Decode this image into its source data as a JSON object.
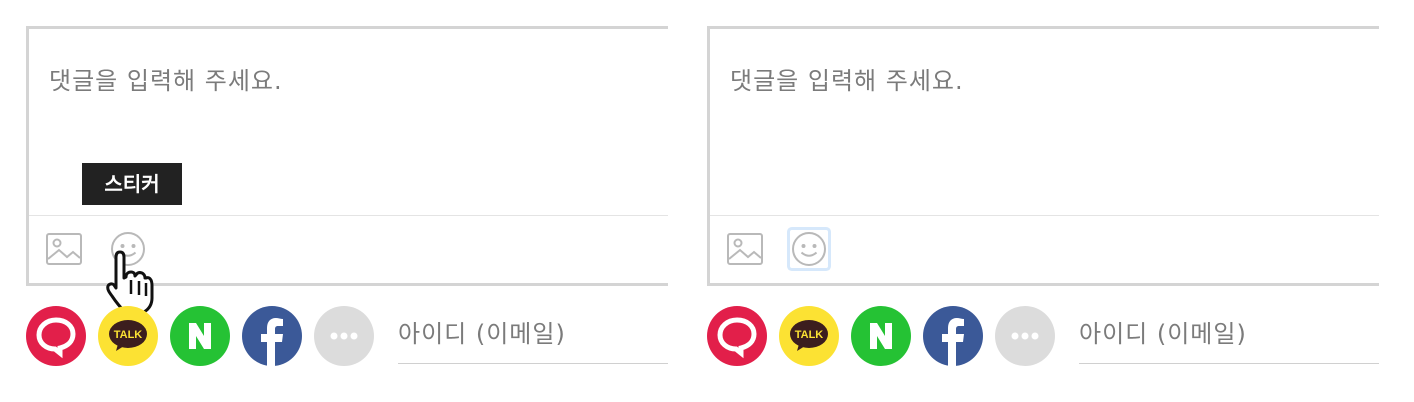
{
  "comment": {
    "placeholder": "댓글을 입력해 주세요."
  },
  "tooltip": {
    "text": "스티커"
  },
  "login": {
    "id_placeholder": "아이디 (이메일)"
  },
  "social_logins": [
    "Daum",
    "KakaoTalk",
    "Naver",
    "Facebook",
    "More"
  ],
  "kakao_badge_text": "TALK",
  "colors": {
    "daum": "#e21f4a",
    "kakao": "#fce233",
    "naver": "#25c234",
    "facebook": "#3b5998",
    "more": "#dcdcdc",
    "tooltip_bg": "#222222"
  }
}
